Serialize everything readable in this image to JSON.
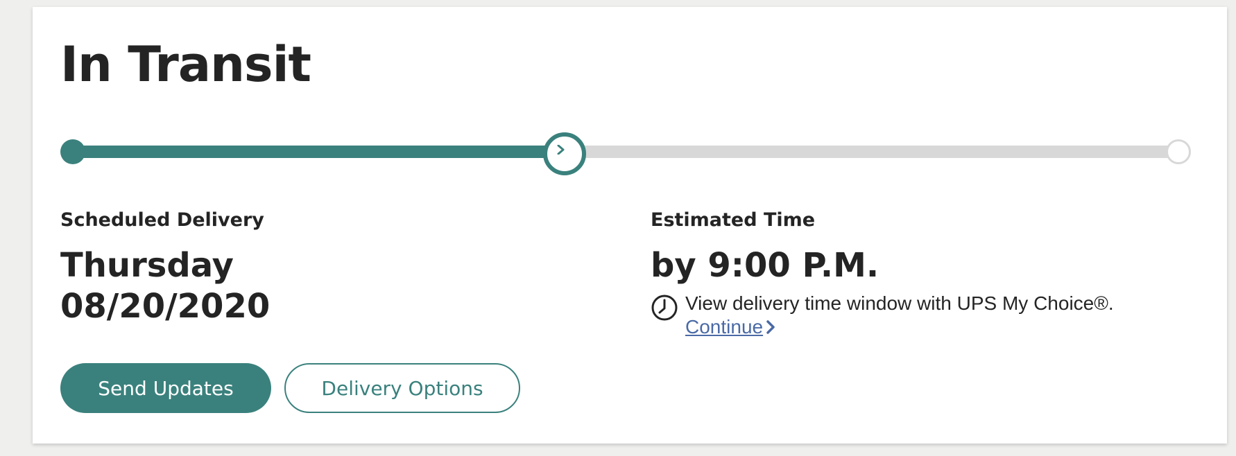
{
  "status": {
    "title": "In Transit"
  },
  "progress": {
    "current_step_fraction": 0.445,
    "steps": [
      "start",
      "in-transit",
      "delivered"
    ],
    "colors": {
      "complete": "#3a817d",
      "incomplete": "#d8d8d8"
    },
    "current_icon": "chevron-right-icon"
  },
  "scheduled": {
    "label": "Scheduled Delivery",
    "day": "Thursday",
    "date": "08/20/2020"
  },
  "estimated": {
    "label": "Estimated Time",
    "value": "by 9:00 P.M.",
    "note_icon": "clock-icon",
    "note_text": "View delivery time window with UPS My Choice®.",
    "link_text": "Continue ",
    "link_icon": "chevron-right-icon"
  },
  "actions": {
    "send_updates_label": "Send Updates",
    "delivery_options_label": "Delivery Options"
  },
  "theme": {
    "accent": "#3a817d",
    "link": "#4a6aa5",
    "text": "#242424"
  }
}
